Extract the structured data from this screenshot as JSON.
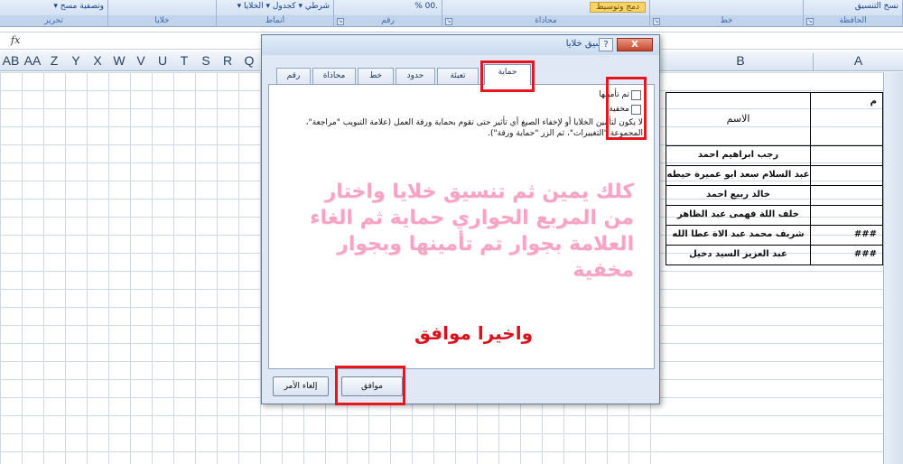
{
  "ribbon": {
    "groups": [
      {
        "label": "الحافظة",
        "controls": "نسخ التنسيق"
      },
      {
        "label": "خط",
        "controls": ""
      },
      {
        "label": "محاذاة",
        "controls": "دمج وتوسيط"
      },
      {
        "label": "رقم",
        "controls": ".00  %"
      },
      {
        "label": "أنماط",
        "controls": "شرطي ▾  كجدول ▾  الخلايا ▾"
      },
      {
        "label": "خلايا",
        "controls": ""
      },
      {
        "label": "تحرير",
        "controls": "وتصفية  مسح ▾"
      }
    ]
  },
  "formula_bar": {
    "fx": "fx",
    "value": ""
  },
  "columns": {
    "left_letters": [
      "AB",
      "AA",
      "Z",
      "Y",
      "X",
      "W",
      "V",
      "U",
      "T",
      "S",
      "R",
      "Q"
    ],
    "B": "B",
    "A": "A"
  },
  "sheet": {
    "header": {
      "col_a": "م",
      "col_b": "الاسم"
    },
    "rows": [
      {
        "name": "رجب ابراهيم احمد",
        "hash": ""
      },
      {
        "name": "عبد السلام سعد ابو عميرة حيطه",
        "hash": ""
      },
      {
        "name": "خالد ربيع احمد",
        "hash": ""
      },
      {
        "name": "خلف اللة فهمى عبد الظاهر",
        "hash": ""
      },
      {
        "name": "شريف محمد عبد الاة عطا الله",
        "hash": "###"
      },
      {
        "name": "عبد العزيز السيد دخيل",
        "hash": "###"
      }
    ]
  },
  "dialog": {
    "title": "تنسيق خلايا",
    "help": "?",
    "close": "X",
    "tabs": [
      "رقم",
      "محاذاة",
      "خط",
      "حدود",
      "تعبئة",
      "حماية"
    ],
    "active_tab": "حماية",
    "checkbox_locked": "تم تأمينها",
    "checkbox_hidden": "مخفية",
    "description": "لا يكون لتأمين الخلايا أو لإخفاء الصيغ أي تأثير حتى تقوم بحماية ورقة العمل (علامة التبويب \"مراجعة\"، المجموعة \"التغييرات\"، ثم الزر \"حماية ورقة\").",
    "ok": "موافق",
    "cancel": "إلغاء الأمر"
  },
  "annotation": {
    "main": "كلك يمين ثم تنسيق خلايا واختار من المربع الحواري حماية ثم الغاء العلامة بجوار تم تأمينها وبجوار مخفية",
    "final": "واخيرا موافق"
  },
  "colors": {
    "annotation_main": "#f6a3c4",
    "annotation_final": "#d9131e",
    "highlight": "#e8151f"
  }
}
